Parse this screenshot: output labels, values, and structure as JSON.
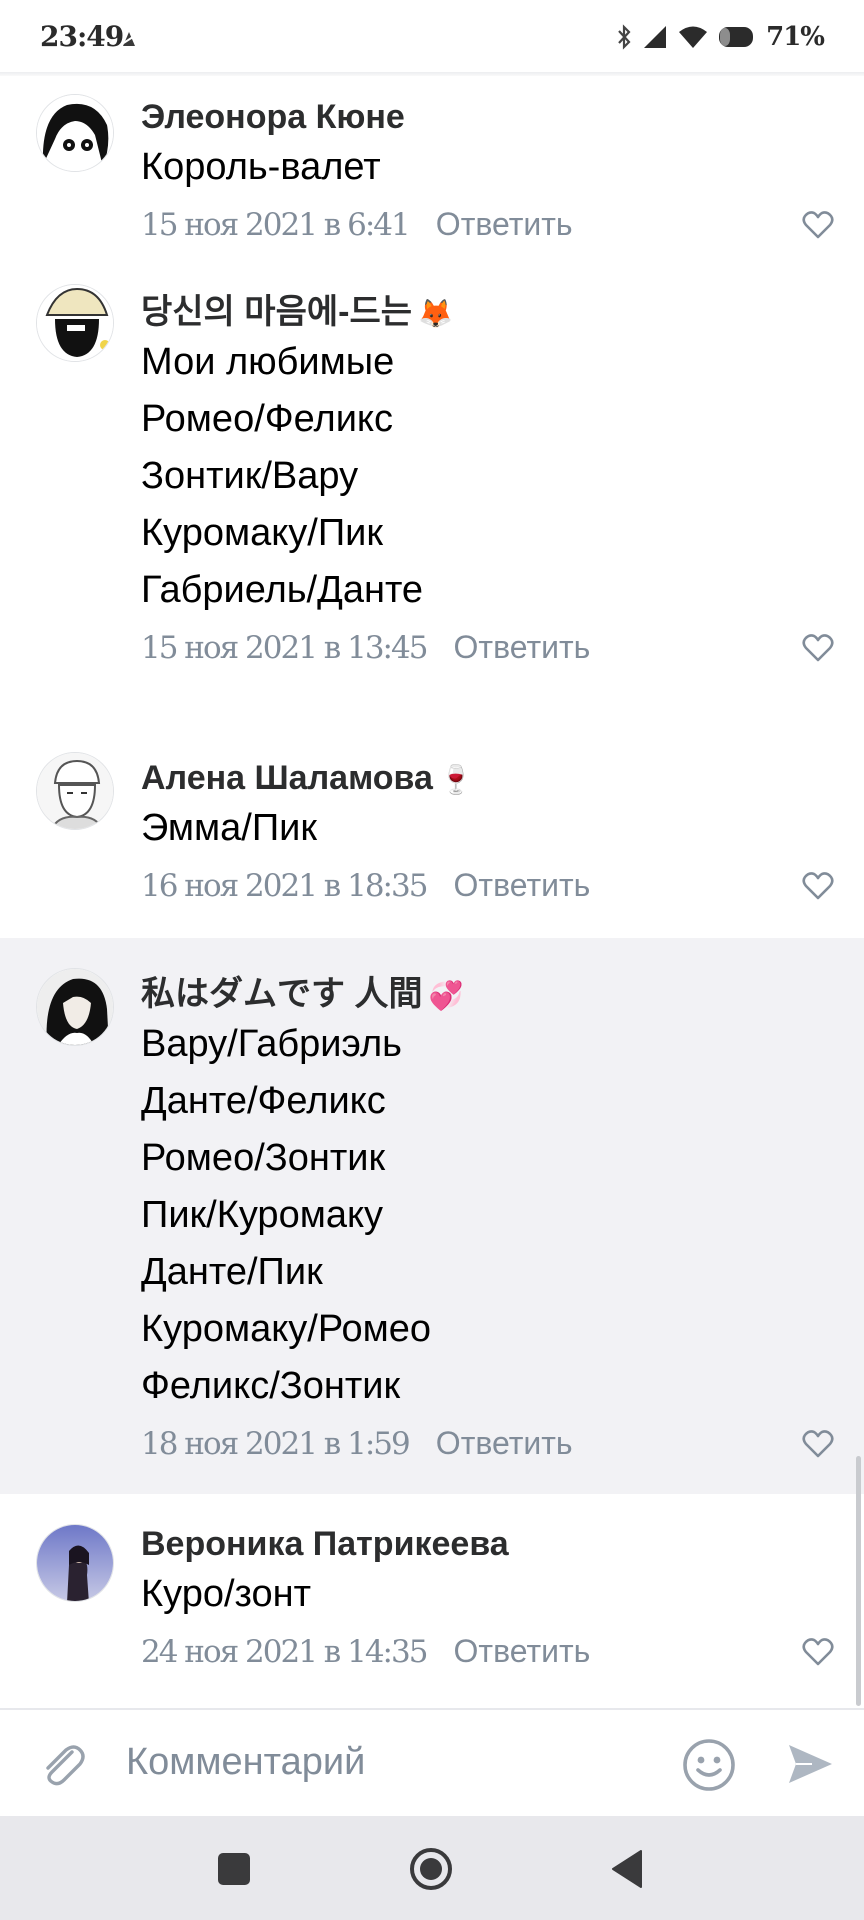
{
  "status_bar": {
    "time": "23:49",
    "battery": "71%",
    "icons": [
      "notification-icon",
      "bluetooth-icon",
      "signal-icon",
      "wifi-icon",
      "battery-icon"
    ]
  },
  "comments": [
    {
      "author": "Элеонора Кюне",
      "author_emoji": "",
      "lines": [
        "Король-валет"
      ],
      "date": "15 ноя 2021 в 6:41",
      "reply": "Ответить"
    },
    {
      "author": "당신의 마음에-드는",
      "author_emoji": "🦊",
      "lines": [
        "Мои любимые",
        "Ромео/Феликс",
        "Зонтик/Вару",
        "Куромаку/Пик",
        "Габриель/Данте"
      ],
      "date": "15 ноя 2021 в 13:45",
      "reply": "Ответить"
    },
    {
      "author": "Алена Шаламова",
      "author_emoji": "🍷",
      "lines": [
        "Эмма/Пик"
      ],
      "date": "16 ноя 2021 в 18:35",
      "reply": "Ответить"
    },
    {
      "author": "私はダムです 人間",
      "author_emoji": "💞",
      "lines": [
        "Вару/Габриэль",
        "Данте/Феликс",
        "Ромео/Зонтик",
        "Пик/Куромаку",
        "Данте/Пик",
        "Куромаку/Ромео",
        "Феликс/Зонтик"
      ],
      "date": "18 ноя 2021 в 1:59",
      "reply": "Ответить"
    },
    {
      "author": "Вероника Патрикеева",
      "author_emoji": "",
      "lines": [
        "Куро/зонт"
      ],
      "date": "24 ноя 2021 в 14:35",
      "reply": "Ответить"
    }
  ],
  "input": {
    "placeholder": "Комментарий",
    "icons": [
      "paperclip-icon",
      "smile-icon",
      "send-icon"
    ]
  },
  "nav": {
    "icons": [
      "recents-square-icon",
      "home-circle-icon",
      "back-triangle-icon"
    ]
  },
  "colors": {
    "accent_gray": "#818c99",
    "highlight_bg": "#f2f2f5",
    "text": "#000000",
    "author": "#2c2d2e"
  }
}
